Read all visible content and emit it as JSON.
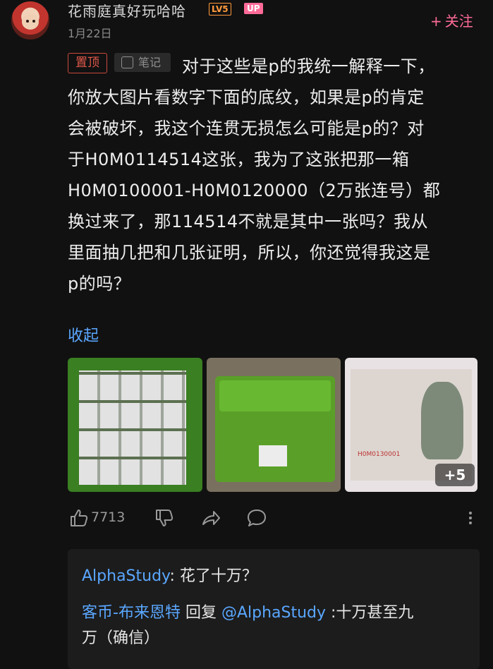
{
  "header": {
    "username": "花雨庭真好玩哈哈",
    "level_badge": "LV5",
    "up_badge": "UP",
    "date": "1月22日",
    "follow_label": "关注",
    "follow_plus": "+"
  },
  "post": {
    "tags": {
      "pinned": "置顶",
      "note": "笔记"
    },
    "lines": [
      "对于这些是p的我统一解释一下，",
      "你放大图片看数字下面的底纹，如果是p的肯定",
      "会被破坏，我这个连贯无损怎么可能是p的？对",
      "于H0M0114514这张，我为了这张把那一箱",
      "H0M0100001-H0M0120000（2万张连号）都",
      "换过来了，那114514不就是其中一张吗？我从",
      "里面抽几把和几张证明，所以，你还觉得我这是",
      "p的吗？"
    ],
    "collapse_label": "收起",
    "more_images_label": "+5",
    "bill_serial": "H0M0130001"
  },
  "actions": {
    "like_count": "7713"
  },
  "replies": [
    {
      "author": "AlphaStudy",
      "sep": ": ",
      "text": "花了十万？"
    },
    {
      "author": "客币-布来恩特",
      "mid": " 回复 ",
      "mention": "@AlphaStudy",
      "text": " :十万甚至九",
      "text2": "万（确信）"
    }
  ],
  "colors": {
    "background": "#111111",
    "accent_pink": "#ff6b98",
    "link_blue": "#5aa7ff",
    "pinned_red": "#e0584a"
  },
  "icons": [
    "thumbs-up-icon",
    "thumbs-down-icon",
    "share-icon",
    "comment-icon",
    "more-icon",
    "note-icon"
  ]
}
